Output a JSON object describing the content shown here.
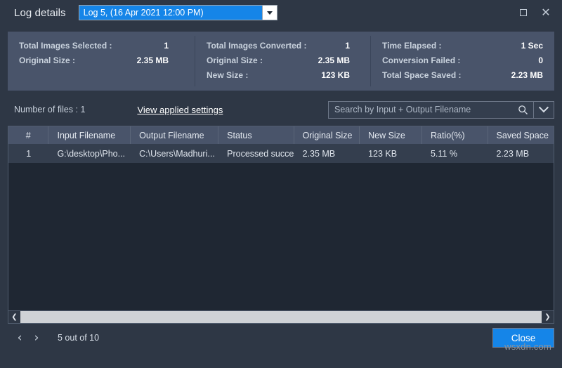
{
  "window": {
    "title": "Log details",
    "maximize_icon": "maximize-icon",
    "close_icon": "close-icon"
  },
  "log_selector": {
    "selected": "Log 5, (16 Apr 2021 12:00 PM)",
    "dropdown_icon": "caret-down-icon"
  },
  "summary": {
    "columns": [
      {
        "rows": [
          {
            "label": "Total Images Selected :",
            "value": "1"
          },
          {
            "label": "Original Size :",
            "value": "2.35 MB"
          }
        ]
      },
      {
        "rows": [
          {
            "label": "Total Images Converted :",
            "value": "1"
          },
          {
            "label": "Original Size :",
            "value": "2.35 MB"
          },
          {
            "label": "New Size :",
            "value": "123 KB"
          }
        ]
      },
      {
        "rows": [
          {
            "label": "Time Elapsed :",
            "value": "1 Sec"
          },
          {
            "label": "Conversion Failed :",
            "value": "0"
          },
          {
            "label": "Total Space Saved :",
            "value": "2.23 MB"
          }
        ]
      }
    ]
  },
  "toolbar": {
    "files_count": "Number of files : 1",
    "applied_settings_link": "View applied settings",
    "search": {
      "placeholder": "Search by Input + Output Filename",
      "value": "",
      "search_icon": "search-icon",
      "dropdown_icon": "chevron-down-icon"
    }
  },
  "table": {
    "headers": [
      "#",
      "Input Filename",
      "Output Filename",
      "Status",
      "Original Size",
      "New Size",
      "Ratio(%)",
      "Saved Space"
    ],
    "rows": [
      {
        "index": "1",
        "input_filename": "G:\\desktop\\Pho...",
        "output_filename": "C:\\Users\\Madhuri...",
        "status": "Processed succes...",
        "original_size": "2.35 MB",
        "new_size": "123 KB",
        "ratio": "5.11 %",
        "saved_space": "2.23 MB"
      }
    ],
    "scrollbar": {
      "left_arrow": "chevron-left-icon",
      "right_arrow": "chevron-right-icon"
    }
  },
  "footer": {
    "prev_icon": "chevron-left-icon",
    "next_icon": "chevron-right-icon",
    "page_status": "5 out of 10",
    "close_label": "Close"
  },
  "watermark": "wsxdn.com",
  "colors": {
    "window_bg": "#2e3745",
    "panel_bg": "#49546a",
    "accent": "#1585e8",
    "table_bg": "#1f2733",
    "row_bg": "#343e4e"
  }
}
